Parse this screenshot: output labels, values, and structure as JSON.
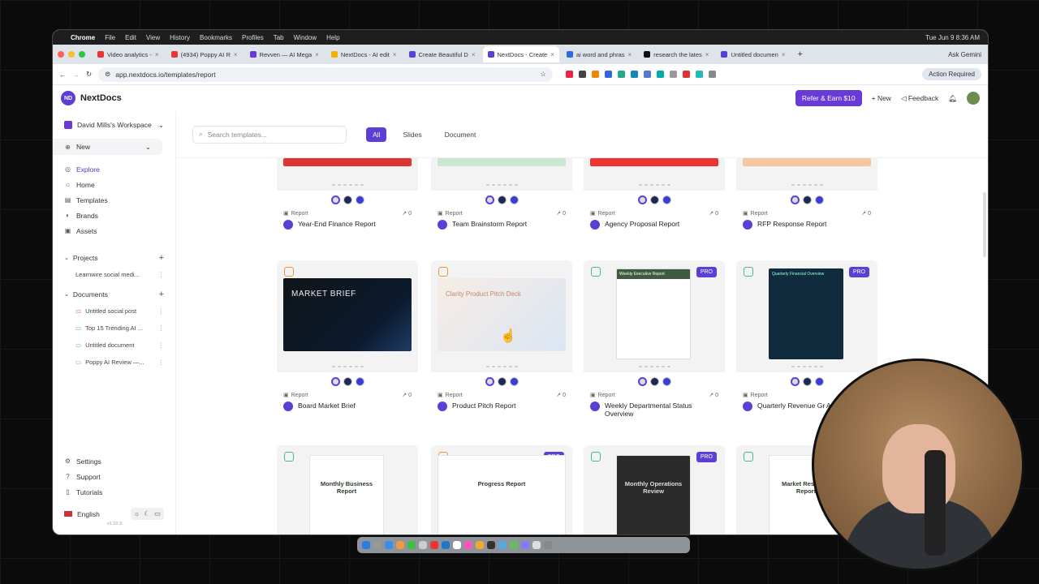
{
  "menubar": {
    "app": "Chrome",
    "items": [
      "File",
      "Edit",
      "View",
      "History",
      "Bookmarks",
      "Profiles",
      "Tab",
      "Window",
      "Help"
    ],
    "clock": "Tue Jun 9  8:36 AM"
  },
  "tabs": [
    {
      "label": "Video analytics - ",
      "color": "#e33"
    },
    {
      "label": "(4934) Poppy AI R",
      "color": "#e33"
    },
    {
      "label": "Revven — AI Mega",
      "color": "#6a3ad9"
    },
    {
      "label": "NextDocs - AI edit",
      "color": "#f0b400"
    },
    {
      "label": "Create Beautiful D",
      "color": "#5b3fd6"
    },
    {
      "label": "NextDocs - Create",
      "color": "#5b3fd6"
    },
    {
      "label": "ai word and phras",
      "color": "#2a6ce0"
    },
    {
      "label": "research the lates",
      "color": "#111"
    },
    {
      "label": "Untitled documen",
      "color": "#5b3fd6"
    }
  ],
  "browser": {
    "url": "app.nextdocs.io/templates/report",
    "gemini": "Ask Gemini",
    "action_required": "Action Required"
  },
  "app": {
    "brand": "NextDocs",
    "refer": "Refer & Earn $10",
    "new": "New",
    "feedback": "Feedback"
  },
  "sidebar": {
    "workspace": "David Mills's Workspace",
    "new": "New",
    "nav": [
      "Explore",
      "Home",
      "Templates",
      "Brands",
      "Assets"
    ],
    "projects_label": "Projects",
    "projects": [
      "Learnwire social medi..."
    ],
    "documents_label": "Documents",
    "documents": [
      "Untitled social post",
      "Top 15 Trending AI ...",
      "Untitled document",
      "Poppy AI Review —..."
    ],
    "bottom": [
      "Settings",
      "Support",
      "Tutorials"
    ],
    "language": "English",
    "version": "v1.10.3"
  },
  "filters": {
    "search_placeholder": "Search templates...",
    "chips": [
      "All",
      "Slides",
      "Document"
    ]
  },
  "row1": [
    {
      "type": "Report",
      "count": "0",
      "title": "Year-End Finance Report"
    },
    {
      "type": "Report",
      "count": "0",
      "title": "Team Brainstorm Report"
    },
    {
      "type": "Report",
      "count": "0",
      "title": "Agency Proposal Report"
    },
    {
      "type": "Report",
      "count": "0",
      "title": "RFP Response Report"
    }
  ],
  "row2": [
    {
      "type": "Report",
      "count": "0",
      "title": "Board Market Brief",
      "thumb_text": "MARKET BRIEF"
    },
    {
      "type": "Report",
      "count": "0",
      "title": "Product Pitch Report",
      "thumb_text": "Clarity Product Pitch Deck"
    },
    {
      "type": "Report",
      "count": "0",
      "title": "Weekly Departmental Status Overview",
      "badge": "PRO",
      "thumb_text": "Weekly Executive Report"
    },
    {
      "type": "Report",
      "count": "",
      "title": "Quarterly Revenue Gr Analysis",
      "badge": "PRO",
      "thumb_text": "Quarterly Financial Overview"
    }
  ],
  "row3": [
    {
      "thumb_text": "Monthly Business Report"
    },
    {
      "badge": "PRO",
      "thumb_text": "Progress Report"
    },
    {
      "badge": "PRO",
      "thumb_text": "Monthly Operations Review"
    },
    {
      "thumb_text": "Market Research Report"
    }
  ]
}
